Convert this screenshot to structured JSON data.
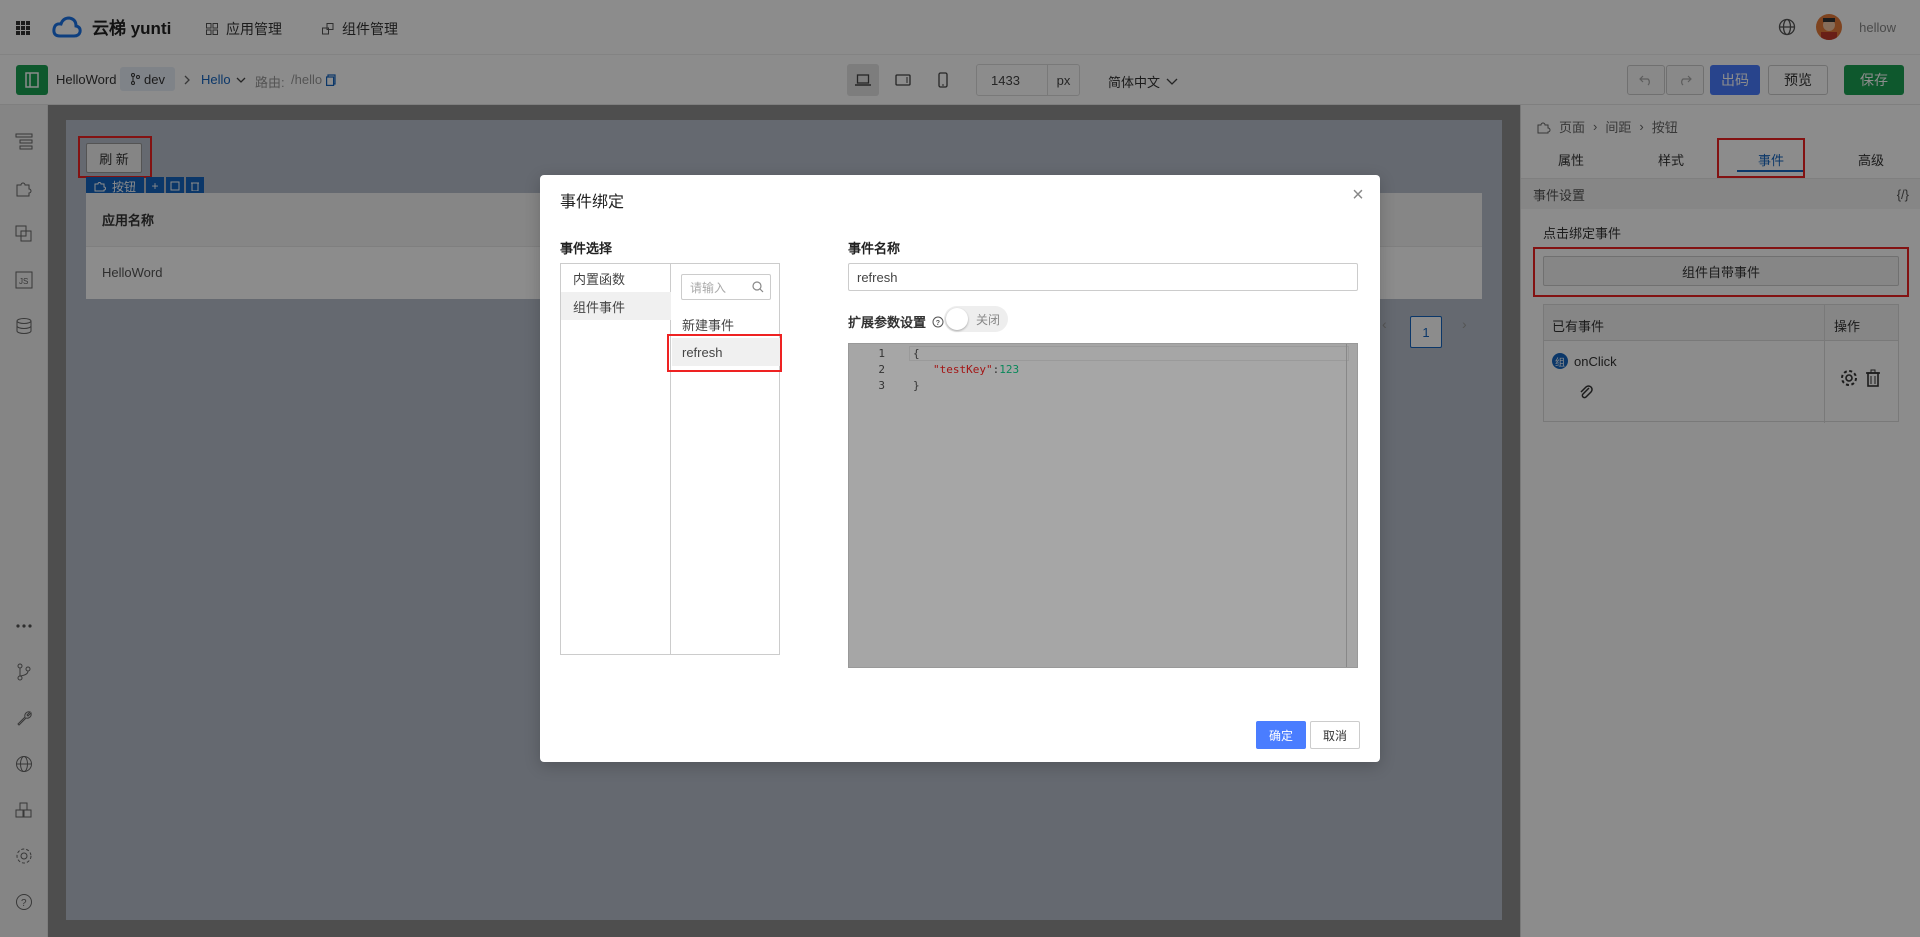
{
  "app": {
    "logo_text": "云梯 yunti",
    "nav": [
      {
        "label": "应用管理",
        "icon": "grid-icon"
      },
      {
        "label": "组件管理",
        "icon": "component-icon"
      }
    ],
    "username": "hellow"
  },
  "toolbar": {
    "app_name": "HelloWord",
    "branch": "dev",
    "page": "Hello",
    "route_label": "路由:",
    "route": "/hello",
    "width_value": "1433",
    "width_unit": "px",
    "language": "简体中文",
    "export_label": "出码",
    "preview_label": "预览",
    "save_label": "保存"
  },
  "canvas": {
    "refresh_button": "刷 新",
    "selection_tag": "按钮",
    "table_header": "应用名称",
    "table_cell": "HelloWord",
    "page_number": "1"
  },
  "panel": {
    "breadcrumb": [
      "页面",
      "间距",
      "按钮"
    ],
    "tabs": [
      "属性",
      "样式",
      "事件",
      "高级"
    ],
    "active_tab": "事件",
    "section_title": "事件设置",
    "section_code": "{/}",
    "bind_label": "点击绑定事件",
    "component_event_button": "组件自带事件",
    "events_header": "已有事件",
    "ops_header": "操作",
    "event_badge": "组",
    "event_name": "onClick"
  },
  "dialog": {
    "title": "事件绑定",
    "select_label": "事件选择",
    "categories": [
      "内置函数",
      "组件事件"
    ],
    "search_placeholder": "请输入",
    "new_event": "新建事件",
    "selected_event": "refresh",
    "name_label": "事件名称",
    "name_value": "refresh",
    "ext_label": "扩展参数设置",
    "toggle_text": "关闭",
    "code_lines": [
      "{",
      "\"testKey\":123",
      "}"
    ],
    "line_numbers": [
      "1",
      "2",
      "3"
    ],
    "code_key": "\"testKey\"",
    "code_num": "123",
    "ok_label": "确定",
    "cancel_label": "取消"
  },
  "colors": {
    "primary": "#1565c0",
    "save_green": "#1aa053",
    "export_blue": "#4a7dff",
    "highlight_red": "#e22222"
  }
}
